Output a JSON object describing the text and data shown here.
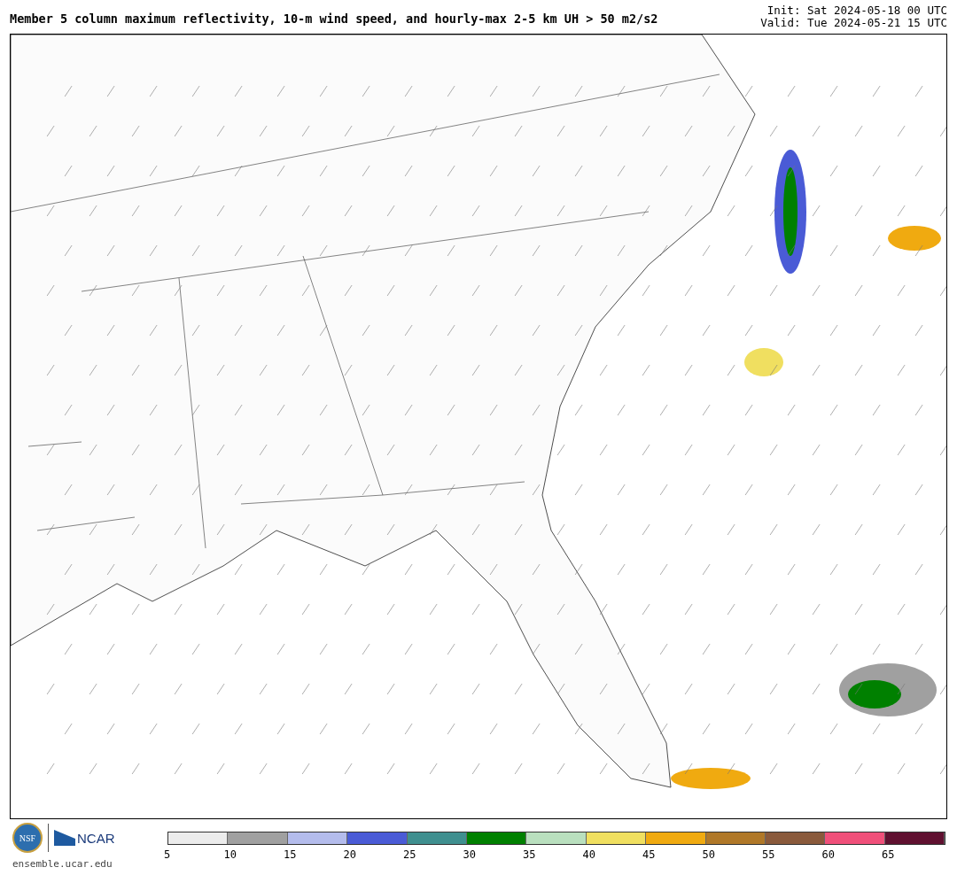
{
  "title": "Member 5 column maximum reflectivity, 10-m wind speed, and hourly-max 2-5 km UH > 50 m2/s2",
  "init": "Init: Sat 2024-05-18 00 UTC",
  "valid": "Valid: Tue 2024-05-21 15 UTC",
  "logos": {
    "ncar": "NCAR",
    "nsf": "NSF"
  },
  "site": "ensemble.ucar.edu",
  "colorbar": {
    "segments": [
      {
        "color": "#ececec"
      },
      {
        "color": "#a0a0a0"
      },
      {
        "color": "#b4bcec"
      },
      {
        "color": "#4a5bd6"
      },
      {
        "color": "#3f8f8f"
      },
      {
        "color": "#008000"
      },
      {
        "color": "#b9dfbe"
      },
      {
        "color": "#f0df60"
      },
      {
        "color": "#f0aa10"
      },
      {
        "color": "#b07828"
      },
      {
        "color": "#8a5a3c"
      },
      {
        "color": "#f0507a"
      },
      {
        "color": "#601030"
      }
    ],
    "labels": [
      "5",
      "10",
      "15",
      "20",
      "25",
      "30",
      "35",
      "40",
      "45",
      "50",
      "55",
      "60",
      "65"
    ]
  }
}
